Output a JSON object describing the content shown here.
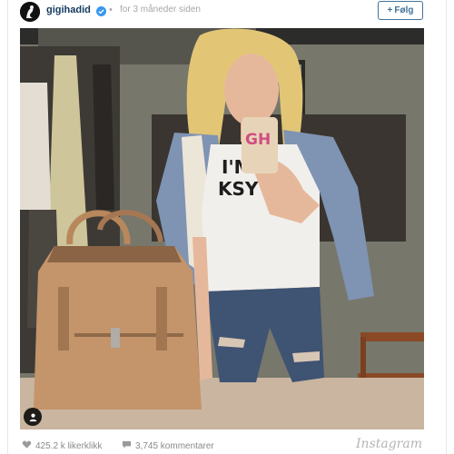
{
  "post": {
    "username": "gigihadid",
    "separator": "•",
    "timestamp": "for 3 måneder siden",
    "follow_label": "Følg",
    "follow_icon": "+",
    "avatar_icon": "user-avatar-icon",
    "verified_icon": "verified-badge-icon"
  },
  "photo": {
    "phone_case_text": "GH",
    "shirt_text_line1": "I'M",
    "shirt_text_line2": "KSY",
    "tag_icon": "user-tag-icon"
  },
  "footer": {
    "likes": "425.2 k likerklikk",
    "comments": "3,745 kommentarer",
    "brand": "Instagram",
    "like_icon": "heart-icon",
    "comment_icon": "comment-bubble-icon"
  },
  "colors": {
    "link": "#12395e",
    "accent": "#3f729b",
    "meta": "#a5a7aa",
    "verified": "#3897f0"
  }
}
